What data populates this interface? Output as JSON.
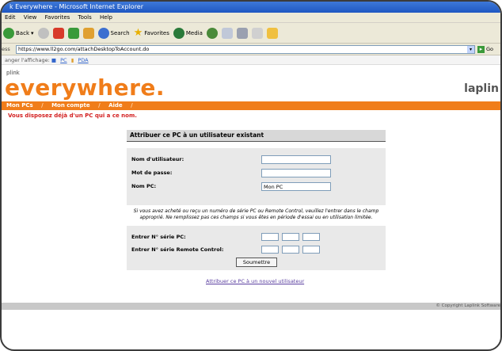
{
  "window": {
    "title": "k Everywhere - Microsoft Internet Explorer"
  },
  "menu": [
    "Edit",
    "View",
    "Favorites",
    "Tools",
    "Help"
  ],
  "toolbar": {
    "back": "Back",
    "search": "Search",
    "favorites": "Favorites",
    "media": "Media"
  },
  "address": {
    "label": "ess",
    "url": "https://www.ll2go.com/attachDesktopToAccount.do",
    "go": "Go"
  },
  "view": {
    "label": "anger l'affichage:",
    "pc": "PC",
    "pda": "PDA"
  },
  "logo": {
    "small": "plink",
    "big": "everywhere.",
    "right": "laplin"
  },
  "nav": [
    "Mon PCs",
    "Mon compte",
    "Aide"
  ],
  "error": "Vous disposez déjà d'un PC qui a ce nom.",
  "panel": {
    "title": "Attribuer ce PC à un utilisateur existant",
    "username_label": "Nom d'utilisateur:",
    "password_label": "Mot de passe:",
    "pc_label": "Nom PC:",
    "pc_value": "Mon PC",
    "note": "Si vous avez acheté ou reçu un numéro de série PC ou Remote Control, veuillez l'entrer dans le champ approprié. Ne remplissez pas ces champs si vous êtes en période d'essai ou en utilisation limitée.",
    "serial_pc_label": "Entrer N° série PC:",
    "serial_rc_label": "Entrer N° série Remote Control:",
    "submit": "Soumettre"
  },
  "link_new_user": "Attribuer ce PC à un nouvel utilisateur",
  "footer": "© Copyright Laplink Software"
}
